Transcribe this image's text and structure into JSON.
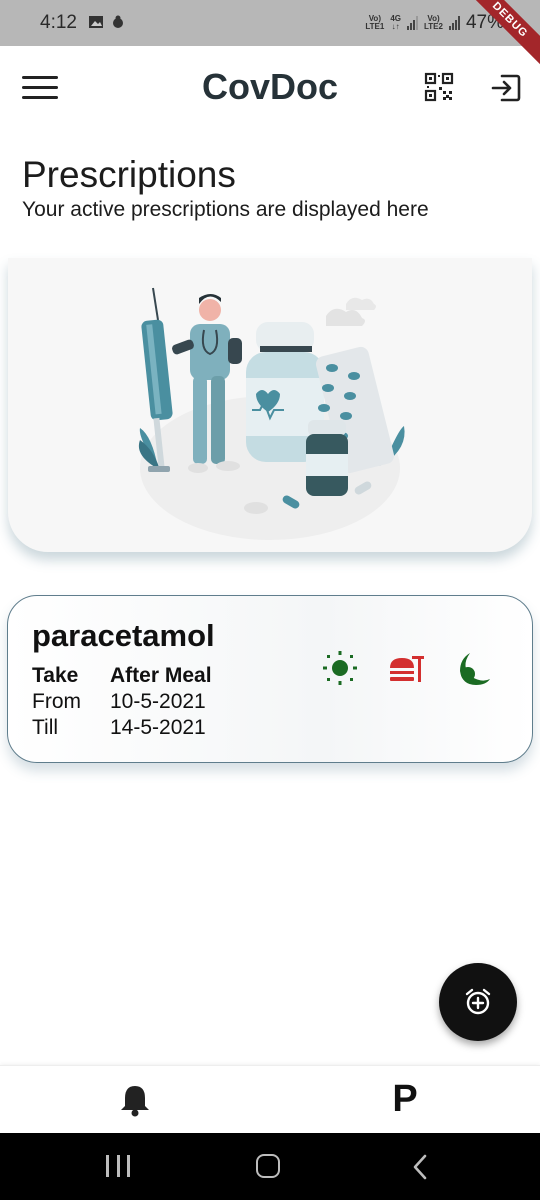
{
  "status_bar": {
    "time": "4:12",
    "sim1_top": "Vo)",
    "sim1_bottom": "LTE1",
    "net_top": "4G",
    "net_bottom": "↓↑",
    "sim2_top": "Vo)",
    "sim2_bottom": "LTE2",
    "battery": "47%",
    "debug_label": "DEBUG"
  },
  "app_bar": {
    "title": "CovDoc",
    "icons": [
      "menu-icon",
      "qr-code-icon",
      "logout-icon"
    ]
  },
  "header": {
    "title": "Prescriptions",
    "subtitle": "Your active prescriptions are displayed here"
  },
  "prescription": {
    "name": "paracetamol",
    "take_label": "Take",
    "take_value": "After Meal",
    "from_label": "From",
    "from_value": "10-5-2021",
    "till_label": "Till",
    "till_value": "14-5-2021",
    "schedule_icons": [
      "sun-icon",
      "meal-icon",
      "moon-icon"
    ],
    "colors": {
      "morning": "#1b6b23",
      "meal": "#d32f2f",
      "night": "#1b6b23"
    }
  },
  "fab": {
    "icon": "alarm-add-icon"
  },
  "bottom_nav": {
    "items": [
      {
        "icon": "bell-icon"
      },
      {
        "label": "P"
      }
    ]
  },
  "colors": {
    "accent_teal": "#4a8fa0",
    "title_dark": "#263238",
    "card_border": "#5f7d8c"
  }
}
